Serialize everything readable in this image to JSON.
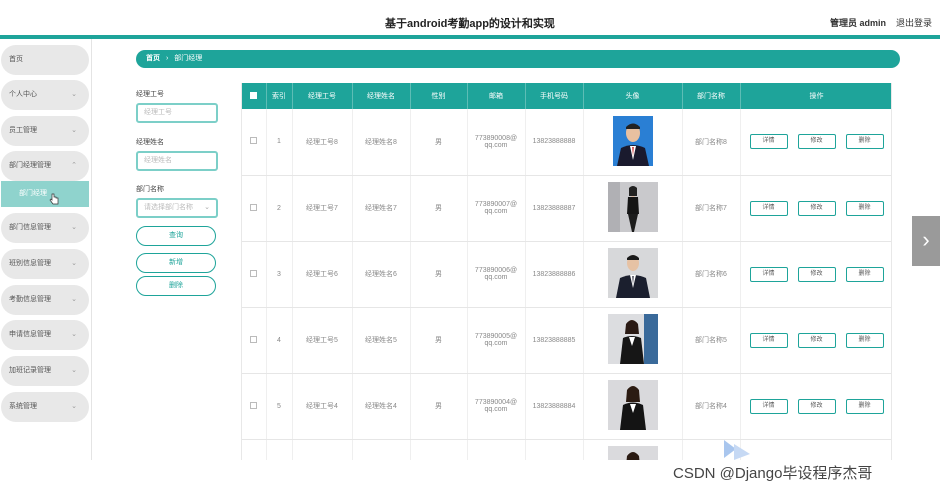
{
  "header": {
    "title": "基于android考勤app的设计和实现",
    "admin": "管理员 admin",
    "logout": "退出登录"
  },
  "sidebar": {
    "items": [
      {
        "label": "首页",
        "chevron": ""
      },
      {
        "label": "个人中心",
        "chevron": "⌄"
      },
      {
        "label": "员工管理",
        "chevron": "⌄"
      },
      {
        "label": "部门经理管理",
        "chevron": "⌃"
      },
      {
        "label": "部门信息管理",
        "chevron": "⌄"
      },
      {
        "label": "班别信息管理",
        "chevron": "⌄"
      },
      {
        "label": "考勤信息管理",
        "chevron": "⌄"
      },
      {
        "label": "申请信息管理",
        "chevron": "⌄"
      },
      {
        "label": "加班记录管理",
        "chevron": "⌄"
      },
      {
        "label": "系统管理",
        "chevron": "⌄"
      }
    ],
    "sub_item": "部门经理"
  },
  "breadcrumb": {
    "home": "首页",
    "sep": "›",
    "current": "部门经理"
  },
  "filters": {
    "id_label": "经理工号",
    "id_placeholder": "经理工号",
    "name_label": "经理姓名",
    "name_placeholder": "经理姓名",
    "dept_label": "部门名称",
    "dept_placeholder": "请选择部门名称",
    "query": "查询",
    "add": "新增",
    "delete": "删除"
  },
  "table": {
    "headers": [
      "",
      "索引",
      "经理工号",
      "经理姓名",
      "性别",
      "邮箱",
      "手机号码",
      "头像",
      "部门名称",
      "操作"
    ],
    "rows": [
      {
        "index": "1",
        "id": "经理工号8",
        "name": "经理姓名8",
        "gender": "男",
        "email1": "773890008@",
        "email2": "qq.com",
        "phone": "13823888888",
        "dept": "部门名称8"
      },
      {
        "index": "2",
        "id": "经理工号7",
        "name": "经理姓名7",
        "gender": "男",
        "email1": "773890007@",
        "email2": "qq.com",
        "phone": "13823888887",
        "dept": "部门名称7"
      },
      {
        "index": "3",
        "id": "经理工号6",
        "name": "经理姓名6",
        "gender": "男",
        "email1": "773890006@",
        "email2": "qq.com",
        "phone": "13823888886",
        "dept": "部门名称6"
      },
      {
        "index": "4",
        "id": "经理工号5",
        "name": "经理姓名5",
        "gender": "男",
        "email1": "773890005@",
        "email2": "qq.com",
        "phone": "13823888885",
        "dept": "部门名称5"
      },
      {
        "index": "5",
        "id": "经理工号4",
        "name": "经理姓名4",
        "gender": "男",
        "email1": "773890004@",
        "email2": "qq.com",
        "phone": "13823888884",
        "dept": "部门名称4"
      }
    ],
    "ops": {
      "detail": "详情",
      "edit": "修改",
      "delete": "删除"
    }
  },
  "watermark": "CSDN @Django毕设程序杰哥",
  "colors": {
    "accent": "#1ea49a",
    "sub_active": "#8fd3cd"
  }
}
